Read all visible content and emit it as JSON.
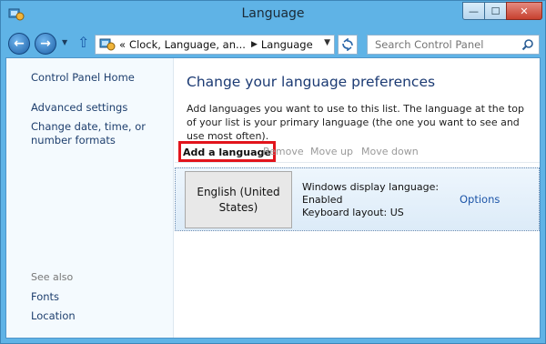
{
  "window": {
    "title": "Language",
    "minimize": "—",
    "maximize": "☐",
    "close": "✕"
  },
  "nav": {
    "breadcrumbs": [
      "Clock, Language, an...",
      "Language"
    ],
    "overflow": "«",
    "search_placeholder": "Search Control Panel"
  },
  "sidebar": {
    "links": [
      "Control Panel Home",
      "Advanced settings",
      "Change date, time, or number formats"
    ],
    "see_also_heading": "See also",
    "see_also": [
      "Fonts",
      "Location"
    ]
  },
  "main": {
    "heading": "Change your language preferences",
    "description": "Add languages you want to use to this list. The language at the top of your list is your primary language (the one you want to see and use most often).",
    "toolbar": {
      "add": "Add a language",
      "remove": "Remove",
      "move_up": "Move up",
      "move_down": "Move down"
    },
    "languages": [
      {
        "name": "English (United States)",
        "display_language_label": "Windows display language:",
        "display_language_status": "Enabled",
        "keyboard_layout": "Keyboard layout: US",
        "options": "Options"
      }
    ]
  },
  "colors": {
    "frame": "#5fb3e6",
    "link": "#1e3f6e",
    "highlight_box": "#e2141c",
    "selected_row": "#dcebf8"
  }
}
